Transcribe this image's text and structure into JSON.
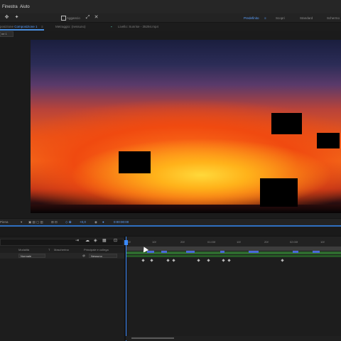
{
  "menubar": {
    "items": [
      "Finestra",
      "Aiuto"
    ]
  },
  "toolbar": {
    "snap_label": "Aggancio",
    "workspaces": [
      "Predefinito",
      "Scopri",
      "Standard",
      "Schermo"
    ],
    "active_workspace": "Predefinito"
  },
  "panel_tabs": {
    "composition": {
      "prefix": "posizione",
      "name": "Composizione 1"
    },
    "footage": "Metraggio: (nessuno)",
    "layer": "Livello: Sunrise - 35294.mp4"
  },
  "viewer": {
    "breadcrumb": "ne 1",
    "resolution": "Piena",
    "exposure": "+0,0",
    "timecode": "0:00:00:00"
  },
  "timeline": {
    "columns": [
      "Modalità",
      "T",
      "Mascherina",
      "Principale e collega"
    ],
    "layer_mode": "Normale",
    "layer_parent": "Nessuno",
    "ruler_labels": [
      "00f",
      "10f",
      "20f",
      "01:00f",
      "10f",
      "20f",
      "02:00f",
      "10f"
    ]
  },
  "colors": {
    "accent": "#4a8fe0",
    "layer_bar": "#2f6b2f",
    "playhead": "#3a8aff"
  },
  "icons": {
    "hand": "hand-tool-icon",
    "pin": "pin-tool-icon",
    "snap": "snap-checkbox-icon",
    "expand": "expand-icon",
    "camera": "snapshot-icon",
    "search": "search-icon"
  }
}
